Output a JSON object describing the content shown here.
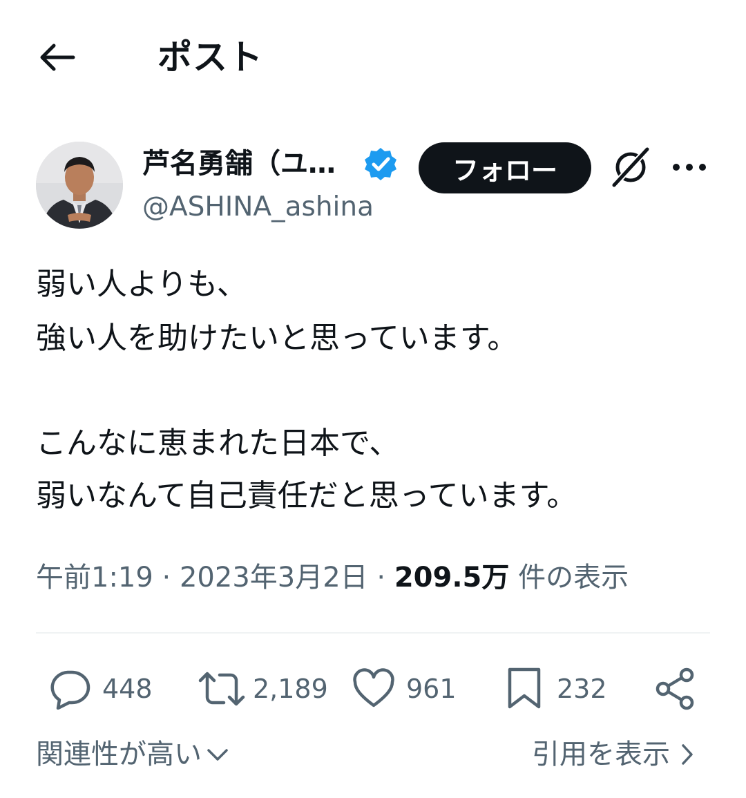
{
  "header": {
    "title": "ポスト",
    "back_icon": "arrow-left-icon"
  },
  "author": {
    "display_name": "芦名勇舗（ユ…",
    "handle": "@ASHINA_ashina",
    "verified": true,
    "follow_label": "フォロー"
  },
  "tweet": {
    "lines": [
      "弱い人よりも、",
      "強い人を助けたいと思っています。",
      "",
      "こんなに恵まれた日本で、",
      "弱いなんて自己責任だと思っています。"
    ]
  },
  "meta": {
    "time": "午前1:19",
    "separator": "·",
    "date": "2023年3月2日",
    "views_count": "209.5万",
    "views_label": "件の表示"
  },
  "actions": {
    "replies": "448",
    "reposts": "2,189",
    "likes": "961",
    "bookmarks": "232"
  },
  "footer": {
    "sort_label": "関連性が高い",
    "quotes_label": "引用を表示"
  },
  "colors": {
    "text": "#0f1419",
    "secondary": "#536471",
    "verified_blue": "#1d9bf0",
    "button_bg": "#0f1419"
  }
}
